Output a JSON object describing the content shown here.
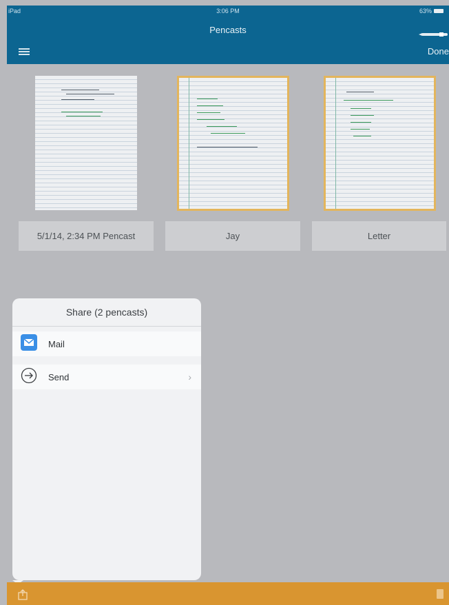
{
  "status": {
    "carrier": "iPad",
    "time": "3:06 PM",
    "battery": "63%"
  },
  "header": {
    "title": "Pencasts",
    "done_label": "Done"
  },
  "pencasts": [
    {
      "label": "5/1/14, 2:34 PM Pencast"
    },
    {
      "label": "Jay"
    },
    {
      "label": "Letter"
    }
  ],
  "share": {
    "title": "Share (2 pencasts)",
    "items": [
      {
        "label": "Mail",
        "icon": "mail-icon"
      },
      {
        "label": "Send",
        "icon": "send-arrow-icon"
      }
    ]
  },
  "colors": {
    "header": "#0c6591",
    "bottombar": "#d99530",
    "selection": "#e3b55c"
  }
}
